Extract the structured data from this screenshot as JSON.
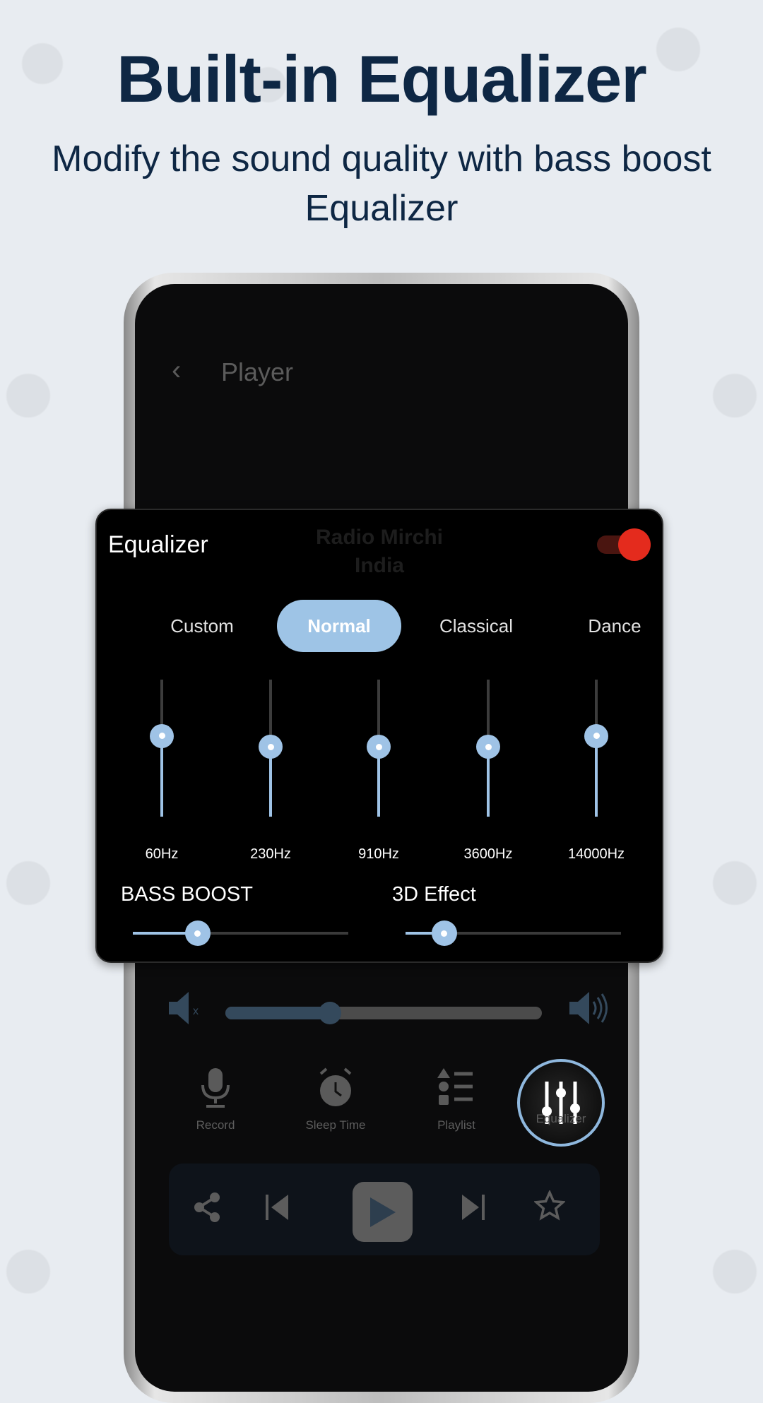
{
  "header": {
    "title": "Built-in Equalizer",
    "subtitle": "Modify the sound quality with bass boost Equalizer"
  },
  "player": {
    "back_icon": "chevron-left-icon",
    "title": "Player",
    "station": "Radio Mirchi",
    "country": "India",
    "volume_level": 0.33,
    "actions": [
      {
        "label": "Record",
        "icon": "microphone-icon"
      },
      {
        "label": "Sleep Time",
        "icon": "alarm-clock-icon"
      },
      {
        "label": "Playlist",
        "icon": "playlist-icon"
      },
      {
        "label": "Equalizer",
        "icon": "equalizer-icon"
      }
    ],
    "controls": [
      "share-icon",
      "skip-previous-icon",
      "play-icon",
      "skip-next-icon",
      "star-icon"
    ]
  },
  "equalizer": {
    "title": "Equalizer",
    "enabled": true,
    "presets": [
      "Custom",
      "Normal",
      "Classical",
      "Dance"
    ],
    "selected_preset": "Normal",
    "bands": [
      {
        "label": "60Hz",
        "level": 0.59
      },
      {
        "label": "230Hz",
        "level": 0.51
      },
      {
        "label": "910Hz",
        "level": 0.51
      },
      {
        "label": "3600Hz",
        "level": 0.51
      },
      {
        "label": "14000Hz",
        "level": 0.59
      }
    ],
    "bass_boost": {
      "label": "BASS BOOST",
      "level": 0.3
    },
    "effect_3d": {
      "label": "3D Effect",
      "level": 0.18
    }
  },
  "colors": {
    "accent": "#9fc3e6",
    "toggle_on": "#e42b1d",
    "heading": "#0e2744"
  }
}
